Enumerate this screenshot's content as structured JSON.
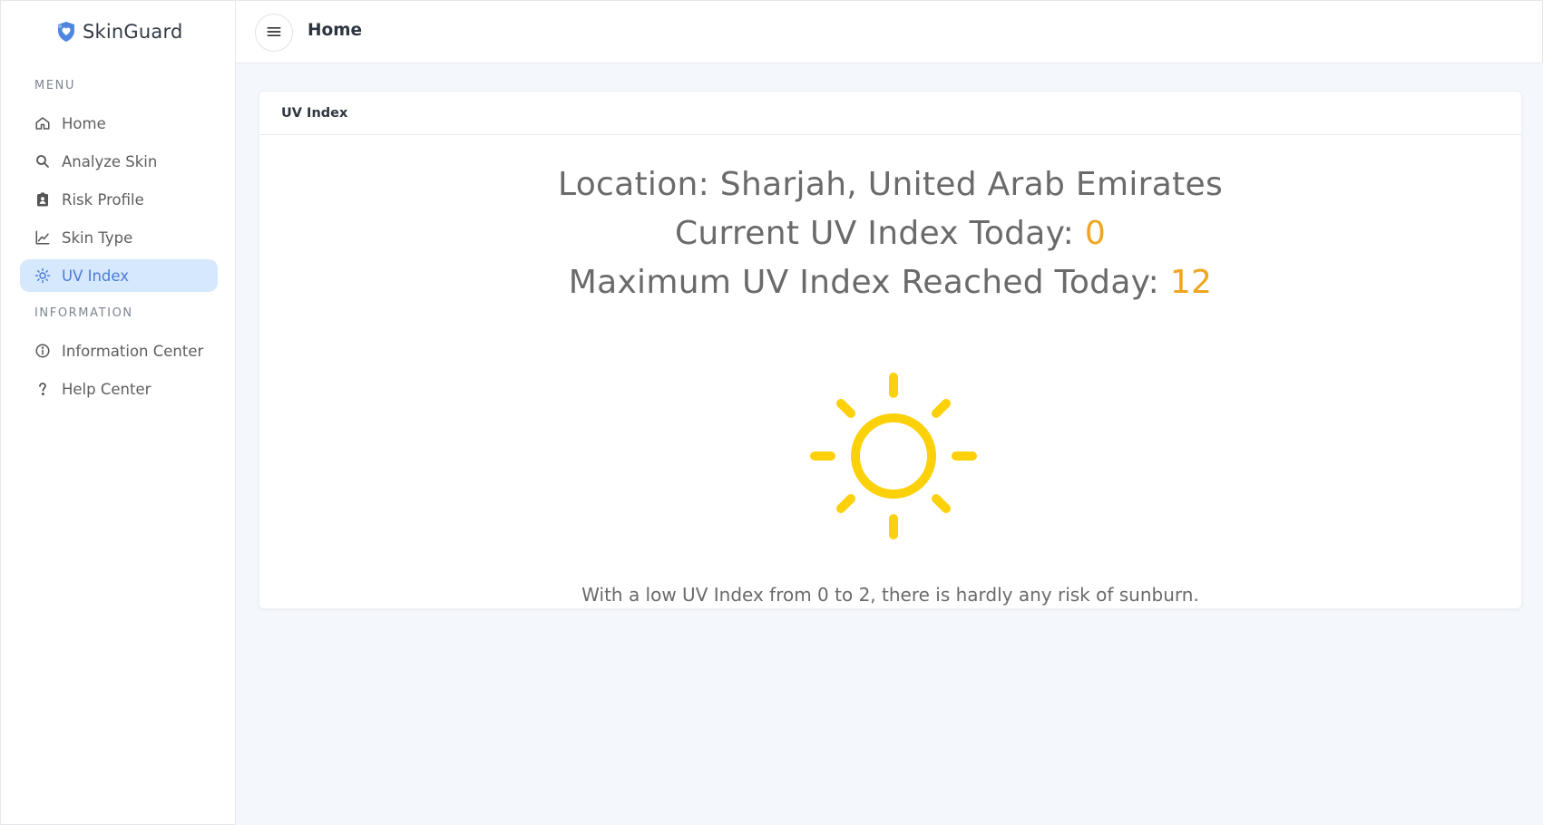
{
  "brand": {
    "name": "SkinGuard",
    "logo_icon": "shield-heart-icon",
    "accent": "#4b7bd8"
  },
  "sidebar": {
    "menu_title": "MENU",
    "menu_items": [
      {
        "label": "Home",
        "icon": "home-icon"
      },
      {
        "label": "Analyze Skin",
        "icon": "search-icon"
      },
      {
        "label": "Risk Profile",
        "icon": "clipboard-user-icon"
      },
      {
        "label": "Skin Type",
        "icon": "chart-line-icon"
      },
      {
        "label": "UV Index",
        "icon": "sun-icon",
        "active": true
      }
    ],
    "info_title": "INFORMATION",
    "info_items": [
      {
        "label": "Information Center",
        "icon": "info-circle-icon"
      },
      {
        "label": "Help Center",
        "icon": "question-icon"
      }
    ]
  },
  "topbar": {
    "title": "Home",
    "menu_icon": "hamburger-icon"
  },
  "card": {
    "header": "UV Index",
    "location_label": "Location: Sharjah, United Arab Emirates",
    "current_label": "Current UV Index Today: ",
    "current_value": "0",
    "max_label": "Maximum UV Index Reached Today: ",
    "max_value": "12",
    "sun_icon": "sun-icon",
    "message": "With a low UV Index from 0 to 2, there is hardly any risk of sunburn.",
    "value_color": "#f0a51e",
    "sun_color": "#fdd10a"
  }
}
